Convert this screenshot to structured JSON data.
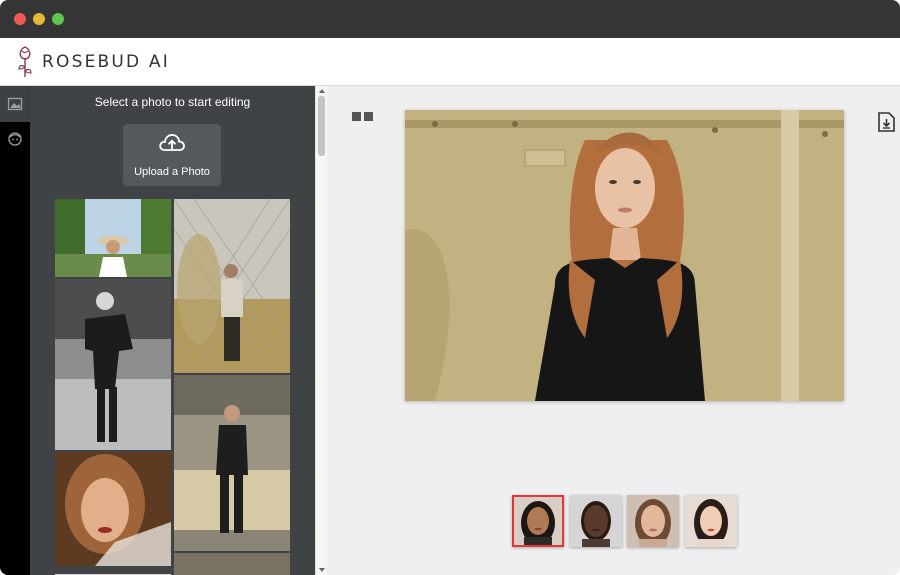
{
  "window": {
    "buttons": [
      "close",
      "minimize",
      "maximize"
    ]
  },
  "app": {
    "name": "ROSEBUD AI",
    "logo_icon": "rose-icon"
  },
  "rail": {
    "items": [
      {
        "icon": "image-icon",
        "active": true
      },
      {
        "icon": "face-icon",
        "active": false
      }
    ]
  },
  "panel": {
    "title": "Select a photo to start editing",
    "upload_label": "Upload a Photo",
    "upload_icon": "cloud-upload-icon",
    "gallery": [
      {
        "name": "woman-sunhat-garden"
      },
      {
        "name": "man-behind-fence"
      },
      {
        "name": "woman-black-white-pose"
      },
      {
        "name": "woman-balcony-black-outfit"
      },
      {
        "name": "woman-closeup-warm-light"
      }
    ]
  },
  "canvas": {
    "compare_icon": "split-view-icon",
    "download_icon": "download-icon",
    "main_photo": "woman-long-hair-black-top"
  },
  "faces": {
    "selected_index": 0,
    "items": [
      {
        "name": "face-option-1"
      },
      {
        "name": "face-option-2"
      },
      {
        "name": "face-option-3"
      },
      {
        "name": "face-option-4"
      }
    ]
  },
  "colors": {
    "panel_bg": "#3f4346",
    "selected_border": "#e23535",
    "accent_logo": "#8b3a4a"
  }
}
